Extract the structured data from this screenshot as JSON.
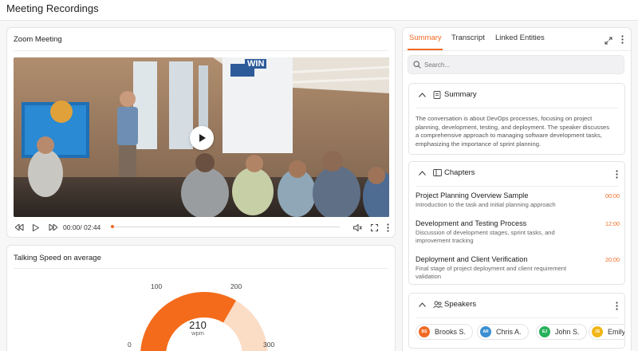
{
  "app": {
    "title": "Meeting Recordings"
  },
  "video_card": {
    "title": "Zoom Meeting",
    "time_current": "00:00",
    "time_total": "02:44",
    "time_separator": "/ ",
    "progress_fraction": 0.0,
    "screen_text": "WIN"
  },
  "speed_card": {
    "title": "Talking Speed on average",
    "value": "210",
    "unit": "wpm",
    "min_label": "0",
    "mark_100": "100",
    "mark_200": "200",
    "max_label": "300",
    "gauge": {
      "value": 210,
      "min": 0,
      "max": 300,
      "highlight_until": 200
    }
  },
  "right_panel": {
    "tabs": [
      {
        "label": "Summary",
        "active": true
      },
      {
        "label": "Transcript",
        "active": false
      },
      {
        "label": "Linked Entities",
        "active": false
      }
    ],
    "search": {
      "placeholder": "Search...",
      "value": ""
    },
    "summary": {
      "title": "Summary",
      "text": "The conversation is about DevOps processes, focusing on project planning, development, testing, and deployment. The speaker discusses a comprehensive approach to managing software development tasks, emphasizing the importance of sprint planning."
    },
    "chapters": {
      "title": "Chapters",
      "items": [
        {
          "title": "Project Planning Overview Sample",
          "desc": "Introduction to the task and initial planning approach",
          "time": "00:00"
        },
        {
          "title": "Development and Testing Process",
          "desc": "Discussion of development stages, sprint tasks, and improvement tracking",
          "time": "12:00"
        },
        {
          "title": "Deployment and Client Verification",
          "desc": "Final stage of project deployment and client requirement validation",
          "time": "20:00"
        }
      ]
    },
    "speakers": {
      "title": "Speakers",
      "items": [
        {
          "initials": "BS",
          "name": "Brooks S.",
          "color": "#f06a24"
        },
        {
          "initials": "AR",
          "name": "Chris A.",
          "color": "#3b8fd1"
        },
        {
          "initials": "EJ",
          "name": "John S.",
          "color": "#28b15a"
        },
        {
          "initials": "JS",
          "name": "Emily",
          "color": "#f2b619"
        }
      ]
    }
  },
  "colors": {
    "accent": "#f06a24",
    "gauge_light": "#fbdcc5"
  }
}
